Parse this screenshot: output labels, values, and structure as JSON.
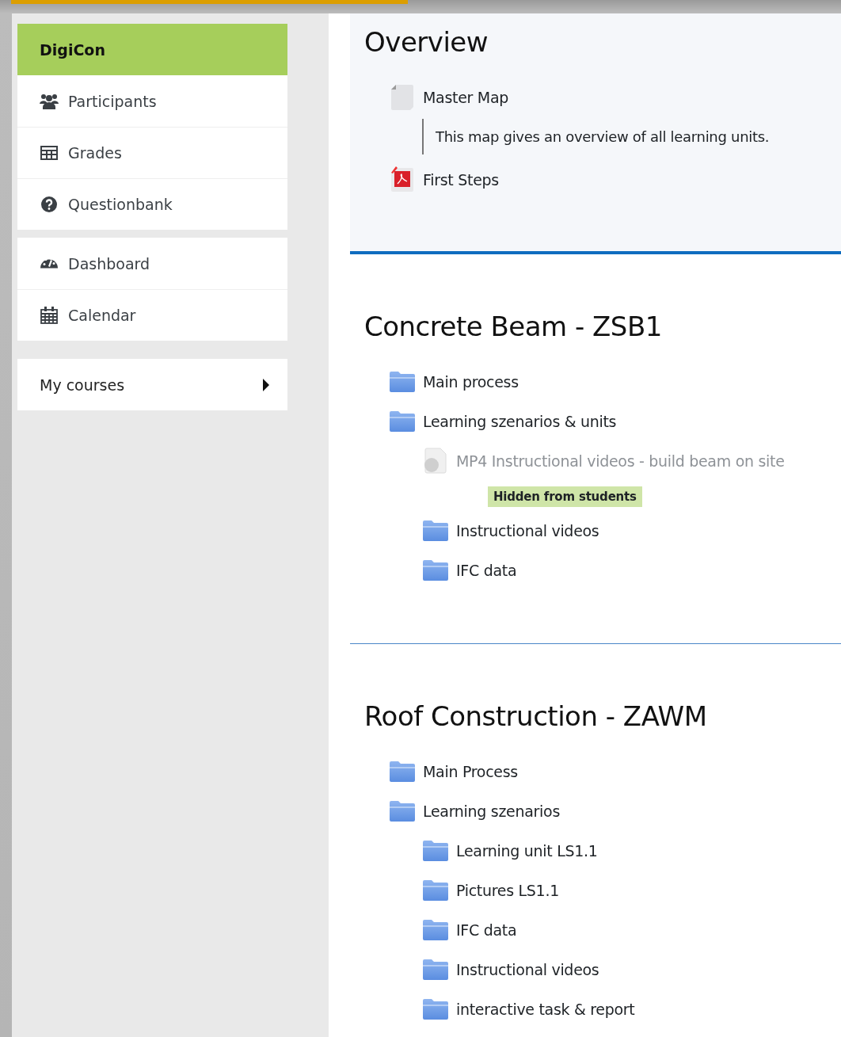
{
  "sidebar": {
    "header": "DigiCon",
    "groups": [
      [
        {
          "kind": "users",
          "label": "Participants"
        },
        {
          "kind": "table",
          "label": "Grades"
        },
        {
          "kind": "question",
          "label": "Questionbank"
        }
      ],
      [
        {
          "kind": "dashboard",
          "label": "Dashboard"
        },
        {
          "kind": "calendar",
          "label": "Calendar"
        }
      ],
      [
        {
          "label": "My courses",
          "expanded": false
        }
      ]
    ]
  },
  "sections": [
    {
      "title": "Overview",
      "items": [
        {
          "kind": "file",
          "label": "Master Map",
          "dimmed": false,
          "description": "This map gives an overview of all learning units."
        },
        {
          "kind": "pdf",
          "label": "First Steps",
          "dimmed": false
        }
      ]
    },
    {
      "title": "Concrete Beam - ZSB1",
      "items": [
        {
          "kind": "folder",
          "label": "Main process",
          "dimmed": false
        },
        {
          "kind": "folder",
          "label": "Learning szenarios & units",
          "dimmed": false,
          "children": [
            {
              "kind": "video",
              "label": "MP4 Instructional videos - build beam on site",
              "dimmed": true,
              "restriction": "Hidden from students"
            },
            {
              "kind": "folder",
              "label": "Instructional videos",
              "dimmed": false
            },
            {
              "kind": "folder",
              "label": "IFC data",
              "dimmed": false
            }
          ]
        }
      ]
    },
    {
      "title": "Roof Construction - ZAWM",
      "items": [
        {
          "kind": "folder",
          "label": "Main Process",
          "dimmed": false
        },
        {
          "kind": "folder",
          "label": "Learning szenarios",
          "dimmed": false,
          "children": [
            {
              "kind": "folder",
              "label": "Learning unit LS1.1",
              "dimmed": false
            },
            {
              "kind": "folder",
              "label": "Pictures LS1.1",
              "dimmed": false
            },
            {
              "kind": "folder",
              "label": "IFC data",
              "dimmed": false
            },
            {
              "kind": "folder",
              "label": "Instructional videos",
              "dimmed": false
            },
            {
              "kind": "folder",
              "label": "interactive task & report",
              "dimmed": false
            }
          ]
        }
      ]
    }
  ]
}
